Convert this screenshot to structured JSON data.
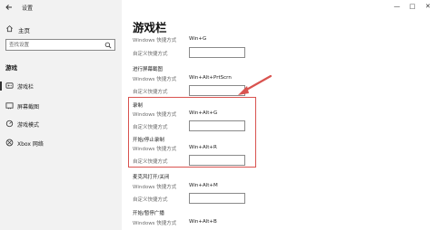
{
  "app": {
    "title": "设置"
  },
  "sidebar": {
    "home_label": "主页",
    "search_placeholder": "查找设置",
    "section_label": "游戏",
    "items": [
      {
        "label": "游戏栏",
        "icon": "gamebar-icon",
        "active": true
      },
      {
        "label": "屏幕截图",
        "icon": "screenshot-icon",
        "active": false
      },
      {
        "label": "游戏模式",
        "icon": "gamemode-icon",
        "active": false
      },
      {
        "label": "Xbox 网络",
        "icon": "xbox-icon",
        "active": false
      }
    ]
  },
  "window_controls": {
    "minimize": "—",
    "maximize": "□",
    "close": "✕"
  },
  "main": {
    "title": "游戏栏",
    "shortcuts": [
      {
        "heading": "",
        "windows_label": "Windows 快捷方式",
        "windows_value": "Win+G",
        "custom_label": "自定义快捷方式"
      },
      {
        "heading": "进行屏幕截图",
        "windows_label": "Windows 快捷方式",
        "windows_value": "Win+Alt+PrtScrn",
        "custom_label": "自定义快捷方式"
      },
      {
        "heading": "录制",
        "windows_label": "Windows 快捷方式",
        "windows_value": "Win+Alt+G",
        "custom_label": "自定义快捷方式"
      },
      {
        "heading": "开始/停止录制",
        "windows_label": "Windows 快捷方式",
        "windows_value": "Win+Alt+R",
        "custom_label": "自定义快捷方式"
      },
      {
        "heading": "麦克风打开/关闭",
        "windows_label": "Windows 快捷方式",
        "windows_value": "Win+Alt+M",
        "custom_label": "自定义快捷方式"
      },
      {
        "heading": "开始/暂停广播",
        "windows_label": "Windows 快捷方式",
        "windows_value": "Win+Alt+B",
        "custom_label": ""
      }
    ]
  },
  "colors": {
    "highlight": "#d9534f",
    "sidebar_bg": "#f2f2f2"
  }
}
